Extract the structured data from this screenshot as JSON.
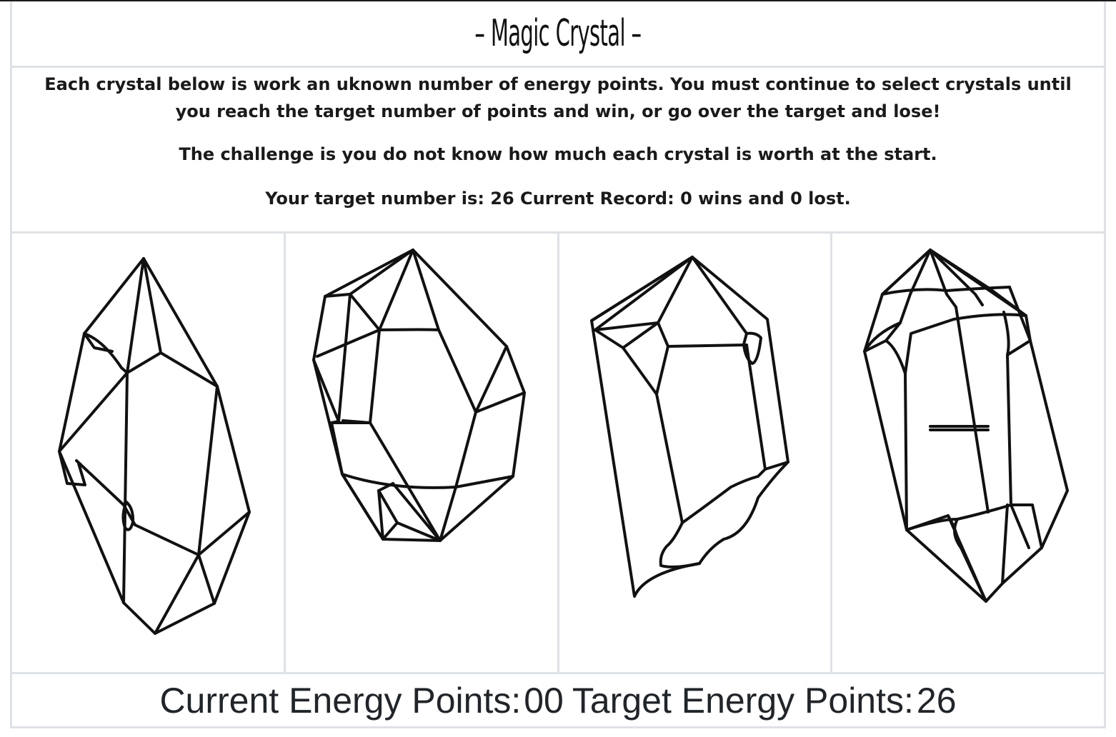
{
  "game": {
    "title": "– Magic Crystal –",
    "instructions": {
      "line1": "Each crystal below is work an uknown number of energy points. You must continue to select crystals until you reach the target number of points and win, or go over the target and lose!",
      "line2": "The challenge is you do not know how much each crystal is worth at the start.",
      "target_label": "Your target number is:",
      "target_value": "26",
      "record_label": "Current Record:",
      "wins": "0",
      "wins_label": "wins and",
      "losses": "0",
      "losses_label": "lost."
    },
    "crystals": [
      {
        "icon": "crystal-1-icon"
      },
      {
        "icon": "crystal-2-icon"
      },
      {
        "icon": "crystal-3-icon"
      },
      {
        "icon": "crystal-4-icon"
      }
    ],
    "score": {
      "current_label": "Current Energy Points:",
      "current_value": "00",
      "target_label": "Target Energy Points:",
      "target_value": "26"
    }
  }
}
